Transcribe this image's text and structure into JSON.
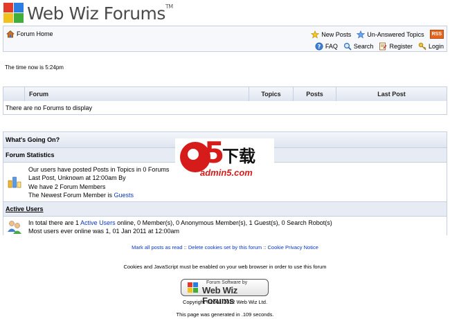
{
  "logo": {
    "name": "Web Wiz Forums",
    "tm": "TM"
  },
  "nav": {
    "home": "Forum Home",
    "new_posts": "New Posts",
    "unanswered": "Un-Answered Topics",
    "rss": "RSS",
    "faq": "FAQ",
    "search": "Search",
    "register": "Register",
    "login": "Login"
  },
  "time_text": "The time now is 5:24pm",
  "forum_table": {
    "headers": [
      "Forum",
      "Topics",
      "Posts",
      "Last Post"
    ],
    "empty_text": "There are no Forums to display"
  },
  "whats_going_on": {
    "title": "What's Going On?",
    "stats_title": "Forum Statistics",
    "stats_lines": [
      "Our users have posted Posts in Topics in 0 Forums",
      "Last Post, Unknown at 12:00am By",
      "We have 2 Forum Members"
    ],
    "newest_prefix": "The Newest Forum Member is",
    "newest_member": "Guests",
    "active_title": "Active Users",
    "active_prefix": "In total there are 1",
    "active_link": "Active Users",
    "active_suffix": "online, 0 Member(s), 0 Anonymous Member(s), 1 Guest(s), 0 Search Robot(s)",
    "active_max": "Most users ever online was 1, 01 Jan 2011 at 12:00am"
  },
  "footer": {
    "mark_read": "Mark all posts as read",
    "delete_cookies": "Delete cookies set by this forum",
    "cookie_privacy": "Cookie Privacy Notice",
    "separator": "::",
    "cookies_note": "Cookies and JavaScript must be enabled on your web browser in order to use this forum",
    "badge_top": "Forum Software by",
    "badge_main": "Web Wiz Forums",
    "copyright": "Copyright ©2001-2012 Web Wiz Ltd.",
    "generated": "This page was generated in .109 seconds."
  },
  "watermark": {
    "cn": "下载",
    "url": "admin5.com",
    "digit": "5"
  },
  "colors": {
    "link": "#0b36c4",
    "border": "#c5cfdf",
    "header_bg": "#dfe5f0",
    "rss": "#e8641b",
    "watermark_red": "#d61b1b"
  }
}
